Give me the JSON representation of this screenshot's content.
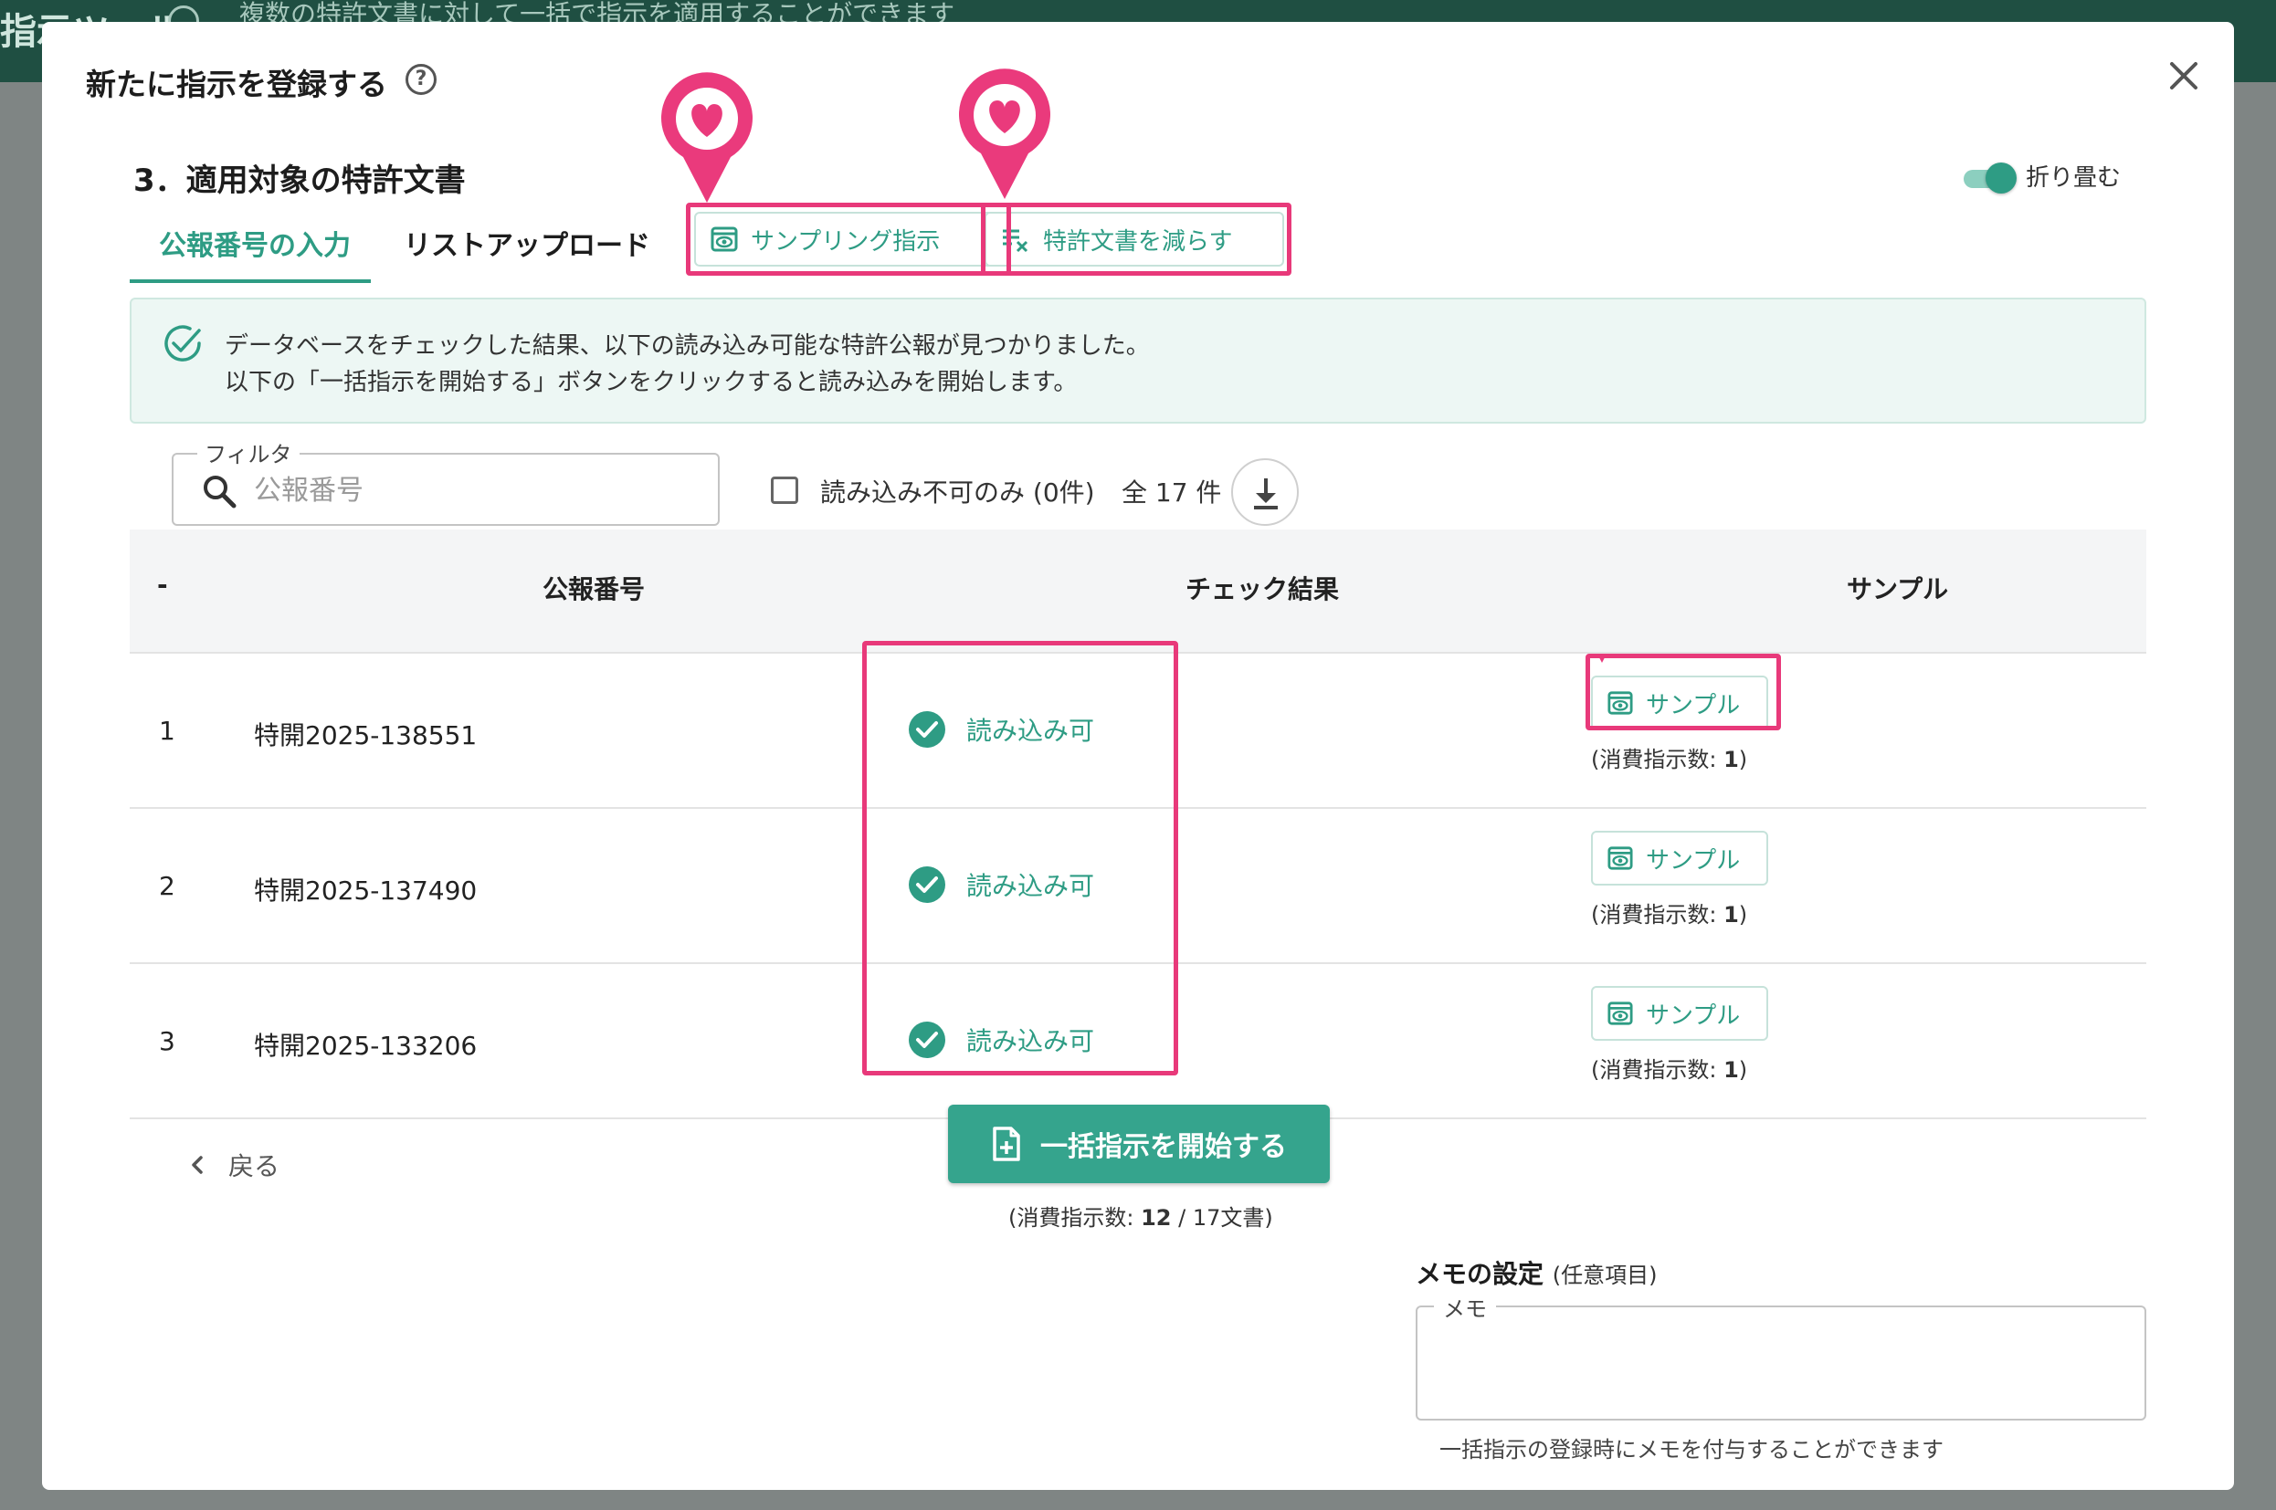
{
  "backdrop": {
    "title": "指示ツール",
    "subtitle": "複数の特許文書に対して一括で指示を適用することができます"
  },
  "modal": {
    "title": "新たに指示を登録する",
    "help_icon": "help-circle-icon",
    "close_icon": "close-icon"
  },
  "section": {
    "title": "3．適用対象の特許文書",
    "collapse_label": "折り畳む",
    "collapse_on": true
  },
  "tabs": [
    {
      "label": "公報番号の入力",
      "active": true
    },
    {
      "label": "リストアップロード",
      "active": false
    }
  ],
  "toolbar": {
    "sampling_label": "サンプリング指示",
    "reduce_label": "特許文書を減らす"
  },
  "info": {
    "line1": "データベースをチェックした結果、以下の読み込み可能な特許公報が見つかりました。",
    "line2": "以下の「一括指示を開始する」ボタンをクリックすると読み込みを開始します。"
  },
  "filter": {
    "legend": "フィルタ",
    "placeholder": "公報番号",
    "value": "",
    "unreadable_only_label": "読み込み不可のみ (0件)",
    "total_label": "全 17 件"
  },
  "table": {
    "headers": {
      "num": "-",
      "pub": "公報番号",
      "check": "チェック結果",
      "sample": "サンプル"
    },
    "rows": [
      {
        "num": "1",
        "pub": "特開2025-138551",
        "status": "読み込み可",
        "sample_label": "サンプル",
        "consume_prefix": "(消費指示数: ",
        "consume_value": "1",
        "consume_suffix": ")"
      },
      {
        "num": "2",
        "pub": "特開2025-137490",
        "status": "読み込み可",
        "sample_label": "サンプル",
        "consume_prefix": "(消費指示数: ",
        "consume_value": "1",
        "consume_suffix": ")"
      },
      {
        "num": "3",
        "pub": "特開2025-133206",
        "status": "読み込み可",
        "sample_label": "サンプル",
        "consume_prefix": "(消費指示数: ",
        "consume_value": "1",
        "consume_suffix": ")"
      }
    ]
  },
  "footer": {
    "back_label": "戻る",
    "start_label": "一括指示を開始する",
    "consume_prefix": "(消費指示数: ",
    "consume_value": "12",
    "consume_suffix": " / 17文書)"
  },
  "memo": {
    "title": "メモの設定",
    "optional": "(任意項目)",
    "legend": "メモ",
    "value": "",
    "help": "一括指示の登録時にメモを付与することができます"
  },
  "colors": {
    "accent": "#2e9c84",
    "highlight": "#e8397a",
    "header_bg": "#1f4f42"
  }
}
